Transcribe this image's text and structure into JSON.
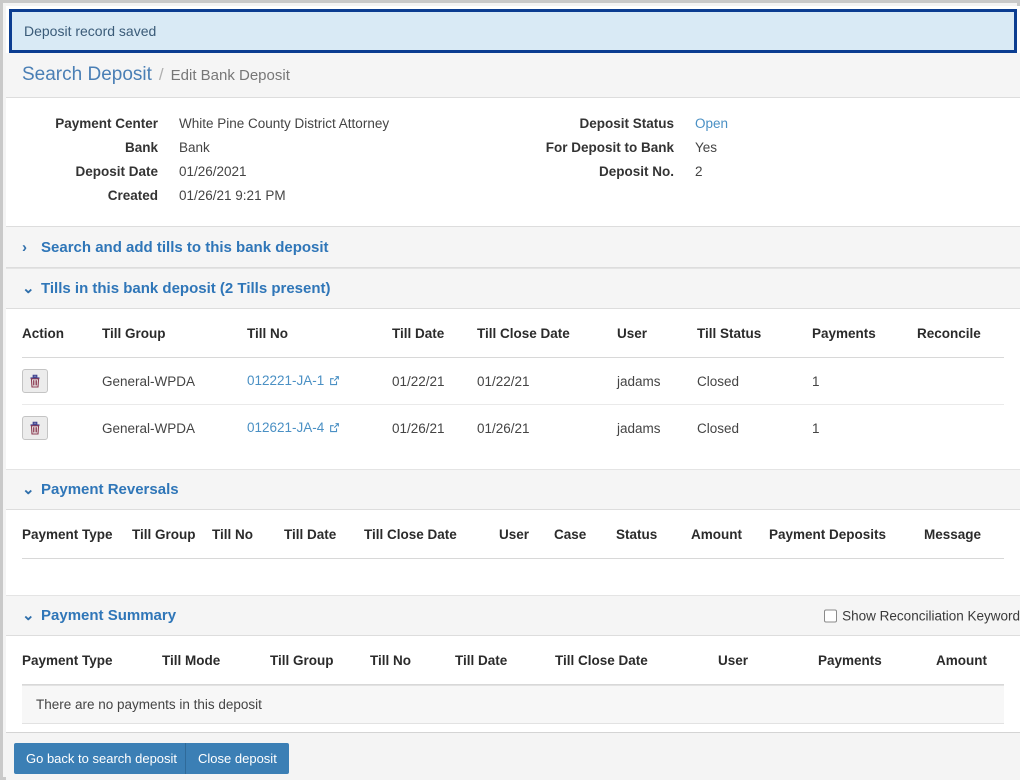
{
  "alert": {
    "message": "Deposit record saved"
  },
  "breadcrumb": {
    "link": "Search Deposit",
    "separator": "/",
    "current": "Edit Bank Deposit"
  },
  "summary": {
    "left": [
      {
        "label": "Payment Center",
        "value": "White Pine County District Attorney"
      },
      {
        "label": "Bank",
        "value": "Bank"
      },
      {
        "label": "Deposit Date",
        "value": "01/26/2021"
      },
      {
        "label": "Created",
        "value": "01/26/21 9:21 PM"
      }
    ],
    "right": [
      {
        "label": "Deposit Status",
        "value": "Open",
        "is_link": true
      },
      {
        "label": "For Deposit to Bank",
        "value": "Yes"
      },
      {
        "label": "Deposit No.",
        "value": "2"
      }
    ]
  },
  "sections": {
    "search_tills": {
      "title": "Search and add tills to this bank deposit",
      "chevron": "›",
      "expanded": false
    },
    "tills": {
      "title": "Tills in this bank deposit (2 Tills present)",
      "chevron": "⌄",
      "expanded": true,
      "columns": [
        "Action",
        "Till Group",
        "Till No",
        "Till Date",
        "Till Close Date",
        "User",
        "Till Status",
        "Payments",
        "Reconcile"
      ],
      "rows": [
        {
          "action": "delete",
          "till_group": "General-WPDA",
          "till_no": "012221-JA-1",
          "till_date": "01/22/21",
          "till_close_date": "01/22/21",
          "user": "jadams",
          "till_status": "Closed",
          "payments": "1",
          "reconcile": ""
        },
        {
          "action": "delete",
          "till_group": "General-WPDA",
          "till_no": "012621-JA-4",
          "till_date": "01/26/21",
          "till_close_date": "01/26/21",
          "user": "jadams",
          "till_status": "Closed",
          "payments": "1",
          "reconcile": ""
        }
      ]
    },
    "payment_reversals": {
      "title": "Payment Reversals",
      "chevron": "⌄",
      "expanded": true,
      "columns": [
        "Payment Type",
        "Till Group",
        "Till No",
        "Till Date",
        "Till Close Date",
        "User",
        "Case",
        "Status",
        "Amount",
        "Payment Deposits",
        "Message"
      ],
      "rows": []
    },
    "payment_summary": {
      "title": "Payment Summary",
      "chevron": "⌄",
      "expanded": true,
      "checkbox_label": "Show Reconciliation Keyword",
      "checkbox_checked": false,
      "columns": [
        "Payment Type",
        "Till Mode",
        "Till Group",
        "Till No",
        "Till Date",
        "Till Close Date",
        "User",
        "Payments",
        "Amount"
      ],
      "empty_message": "There are no payments in this deposit"
    }
  },
  "footer": {
    "back_button": "Go back to search deposit",
    "close_button": "Close deposit"
  },
  "colors": {
    "accent_blue": "#2f76b8",
    "link_blue": "#4a90c4",
    "alert_border": "#0b3d91",
    "alert_bg": "#d9eaf5",
    "button_blue": "#3b7fb5"
  }
}
